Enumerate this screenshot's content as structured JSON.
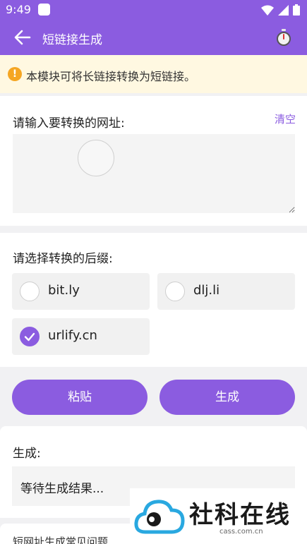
{
  "status_bar": {
    "time": "9:49"
  },
  "app_bar": {
    "title": "短链接生成"
  },
  "notice": {
    "icon_glyph": "!",
    "text": "本模块可将长链接转换为短链接。"
  },
  "url_section": {
    "label": "请输入要转换的网址:",
    "clear_label": "清空",
    "input_value": "",
    "input_placeholder": ""
  },
  "suffix_section": {
    "label": "请选择转换的后缀:",
    "options": [
      {
        "label": "bit.ly",
        "selected": false
      },
      {
        "label": "dlj.li",
        "selected": false
      },
      {
        "label": "urlify.cn",
        "selected": true
      }
    ]
  },
  "actions": {
    "paste_label": "粘贴",
    "generate_label": "生成"
  },
  "result_section": {
    "label": "生成:",
    "value": "等待生成结果..."
  },
  "faq": {
    "label": "短网址生成常见问题"
  },
  "watermark": {
    "name": "社科在线",
    "domain": "cass.com.cn"
  },
  "colors": {
    "accent": "#8b5ce0",
    "notice_bg": "#fff8e1",
    "notice_icon": "#f5a623"
  },
  "icons": {
    "back": "arrow-left-icon",
    "timer": "stopwatch-icon",
    "notice": "warning-circle-icon",
    "check": "check-icon"
  }
}
